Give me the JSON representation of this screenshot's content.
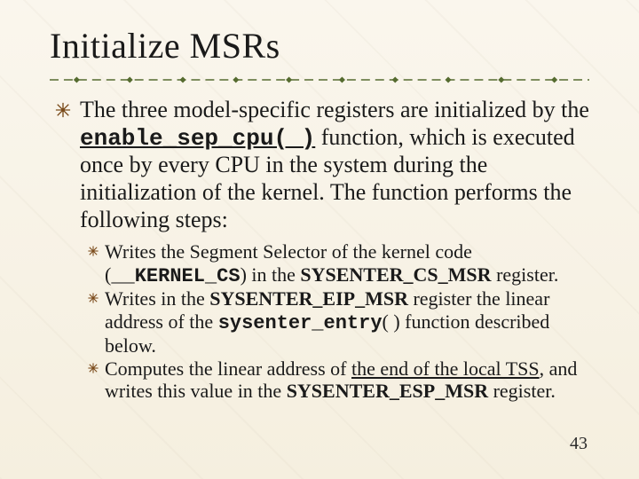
{
  "title": "Initialize MSRs",
  "main": {
    "pre": "The three model-specific registers are initialized by the ",
    "func": "enable_sep_cpu( )",
    "post": " function, which is executed once by every CPU in the system during the initialization of the kernel. The function performs the following steps:"
  },
  "sub": {
    "s1a": "Writes the Segment Selector of the kernel code (",
    "s1code": "__KERNEL_CS",
    "s1b": ") in the ",
    "s1reg": "SYSENTER_CS_MSR",
    "s1c": " register.",
    "s2a": "Writes in the ",
    "s2reg": "SYSENTER_EIP_MSR",
    "s2b": " register the linear address of the ",
    "s2code": "sysenter_entry",
    "s2c": "( ) function described below.",
    "s3a": "Computes the linear address of ",
    "s3u": "the end of the local TSS",
    "s3b": ", and writes this value in the ",
    "s3reg": "SYSENTER_ESP_MSR",
    "s3c": " register."
  },
  "page": "43"
}
